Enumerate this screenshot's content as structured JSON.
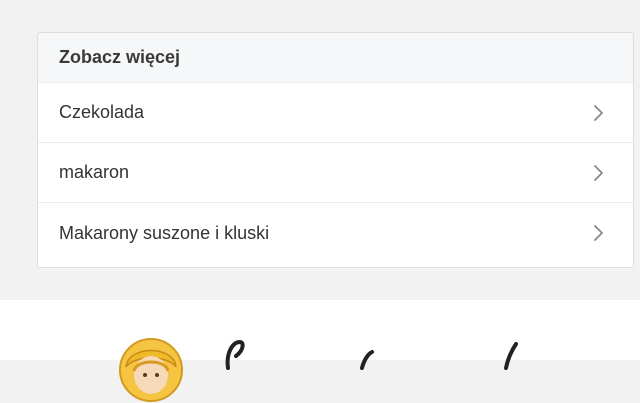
{
  "section": {
    "title": "Zobacz więcej",
    "items": [
      {
        "label": "Czekolada"
      },
      {
        "label": "makaron"
      },
      {
        "label": "Makarony suszone i kluski"
      }
    ]
  },
  "icons": {
    "row_chevron": "chevron-right-icon",
    "footer_avatar": "avatar-illustration",
    "footer_logo": "script-logo"
  },
  "colors": {
    "page_background": "#f2f2f2",
    "card_background": "#ffffff",
    "header_background": "#f6f7f8",
    "text": "#333333",
    "chevron": "#888888"
  }
}
